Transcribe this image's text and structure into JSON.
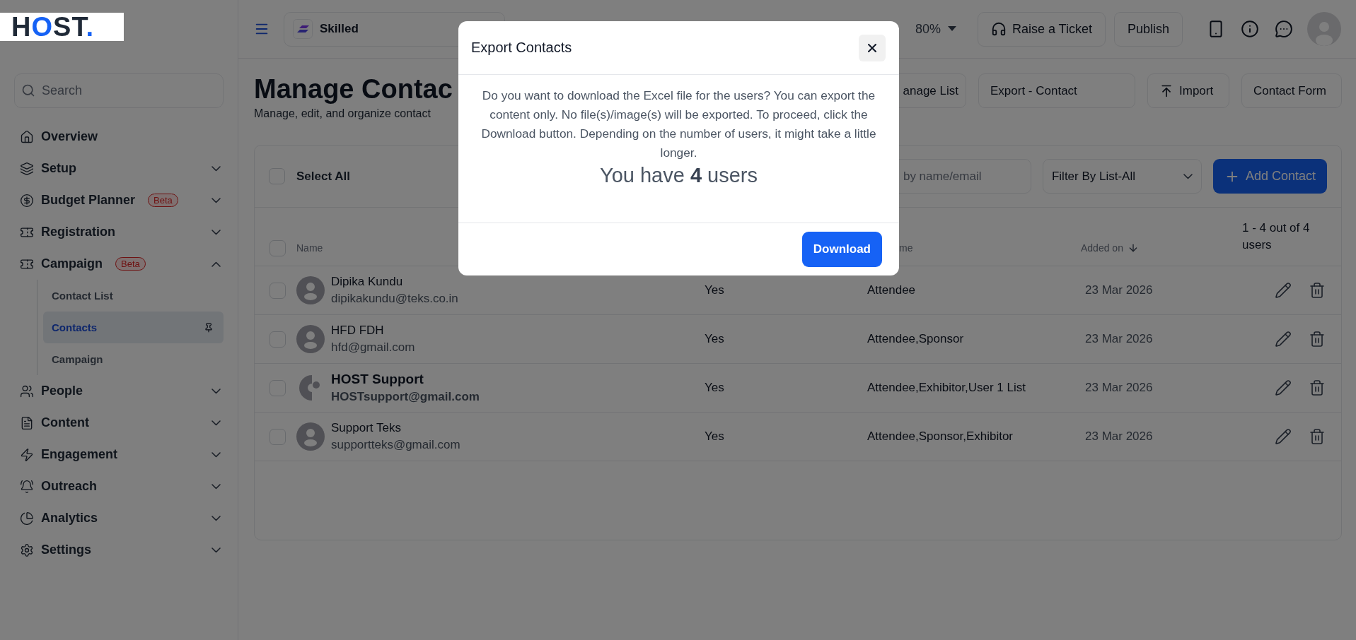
{
  "logo": "HOST.",
  "sidebar": {
    "search": {
      "placeholder": "Search"
    },
    "items": [
      {
        "label": "Overview"
      },
      {
        "label": "Setup",
        "expanded": false
      },
      {
        "label": "Budget Planner",
        "badge": "Beta",
        "expanded": false
      },
      {
        "label": "Registration",
        "expanded": false
      },
      {
        "label": "Campaign",
        "badge": "Beta",
        "expanded": true,
        "children": [
          {
            "label": "Contact List",
            "selected": false
          },
          {
            "label": "Contacts",
            "selected": true
          },
          {
            "label": "Campaign",
            "selected": false
          }
        ]
      },
      {
        "label": "People",
        "expanded": false
      },
      {
        "label": "Content",
        "expanded": false
      },
      {
        "label": "Engagement",
        "expanded": false
      },
      {
        "label": "Outreach",
        "expanded": false
      },
      {
        "label": "Analytics",
        "expanded": false
      },
      {
        "label": "Settings",
        "expanded": false
      }
    ]
  },
  "topbar": {
    "event": "Skilled",
    "zoom": "80%",
    "buttons": [
      "Raise a Ticket",
      "Publish"
    ]
  },
  "page": {
    "title": "Manage Contac",
    "subtitle": "Manage, edit, and organize contact",
    "actions": [
      "anage List",
      "Export - Contact",
      "Import",
      "Contact Form"
    ]
  },
  "toolbar": {
    "select_all": {
      "label": "Select All",
      "checked": false
    },
    "search": {
      "placeholder": "by name/email"
    },
    "filter": {
      "value": "Filter By List-All"
    },
    "add_button": "Add Contact"
  },
  "table": {
    "header": {
      "checked": false,
      "name": "Name",
      "column_4": "me",
      "added_on": "Added on",
      "count": "1 - 4 out of 4 users"
    },
    "rows": [
      {
        "kind": "default",
        "checked": false,
        "name": "Dipika Kundu",
        "email": "dipikakundu@teks.co.in",
        "column_3": "Yes",
        "lists": "Attendee",
        "added_on": "23 Mar 2026"
      },
      {
        "kind": "default",
        "checked": false,
        "name": "HFD FDH",
        "email": "hfd@gmail.com",
        "column_3": "Yes",
        "lists": "Attendee,Sponsor",
        "added_on": "23 Mar 2026"
      },
      {
        "kind": "broken",
        "checked": false,
        "name": "HOST Support",
        "email": "HOSTsupport@gmail.com",
        "column_3": "Yes",
        "lists": "Attendee,Exhibitor,User 1 List",
        "added_on": "23 Mar 2026"
      },
      {
        "kind": "default",
        "checked": false,
        "name": "Support Teks",
        "email": "supportteks@gmail.com",
        "column_3": "Yes",
        "lists": "Attendee,Sponsor,Exhibitor",
        "added_on": "23 Mar 2026"
      }
    ]
  },
  "modal": {
    "title": "Export Contacts",
    "message": "Do you want to download the Excel file for the users? You can export the content only. No file(s)/image(s) will be exported. To proceed, click the Download button. Depending on the number of users, it might take a little longer.",
    "summary": "You have **4** users",
    "button": "Download"
  }
}
